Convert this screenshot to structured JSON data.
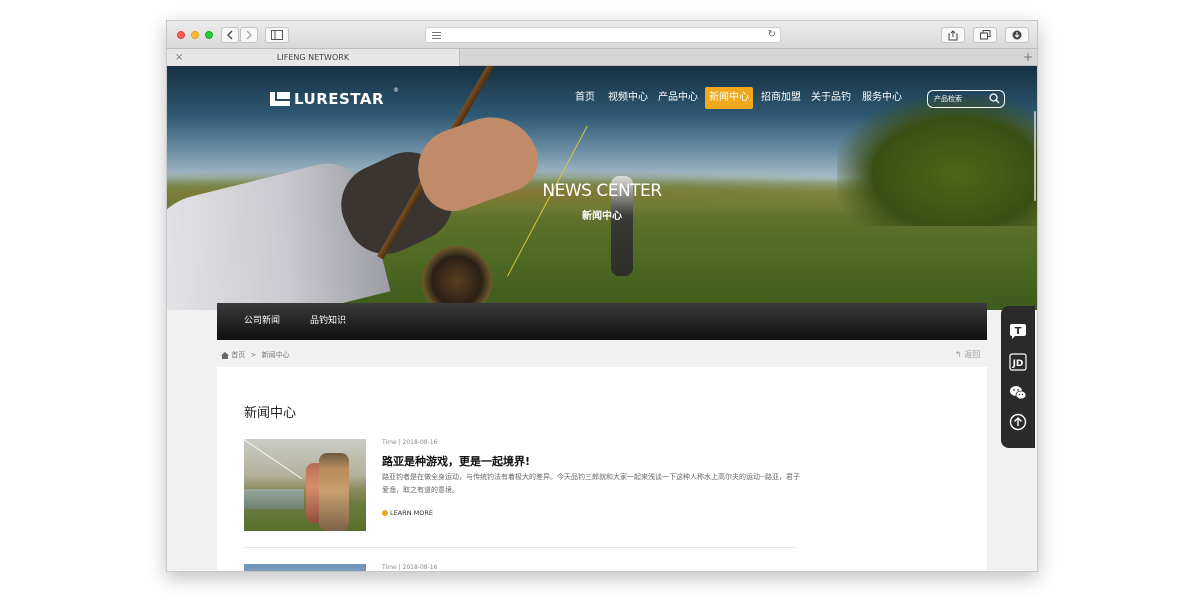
{
  "browser": {
    "tab_title": "LIFENG NETWORK",
    "tab_close": "×",
    "new_tab": "+"
  },
  "site": {
    "logo_text": "LURESTAR",
    "logo_reg": "®",
    "nav": [
      {
        "label": "首页",
        "active": false
      },
      {
        "label": "视频中心",
        "active": false
      },
      {
        "label": "产品中心",
        "active": false
      },
      {
        "label": "新闻中心",
        "active": true
      },
      {
        "label": "招商加盟",
        "active": false
      },
      {
        "label": "关于品钓",
        "active": false
      },
      {
        "label": "服务中心",
        "active": false
      }
    ],
    "search_placeholder": "产品检索",
    "accent_color": "#f0a81c"
  },
  "hero": {
    "title": "NEWS CENTER",
    "subtitle": "新闻中心"
  },
  "subnav": {
    "items": [
      "公司新闻",
      "品钓知识"
    ]
  },
  "breadcrumb": {
    "home": "首页",
    "separator": ">",
    "current": "新闻中心",
    "back": "返回"
  },
  "content": {
    "heading": "新闻中心",
    "news": [
      {
        "meta": "Time | 2018-08-16",
        "title": "路亚是种游戏，更是一起境界!",
        "desc": "路亚钓者是在做全身运动，与传统钓法有着极大的差异。今天品钓三郎就和大家一起来浅谈一下这种人称水上高尔夫的运动--路亚，君子爱渔，取之有道的意境。",
        "more": "LEARN MORE"
      },
      {
        "meta": "Time | 2018-08-16"
      }
    ]
  },
  "side_toolbar": {
    "icons": [
      "tmall-icon",
      "jd-icon",
      "wechat-icon",
      "back-to-top-icon"
    ],
    "jd_label": "JD",
    "tmall_label": "T"
  }
}
